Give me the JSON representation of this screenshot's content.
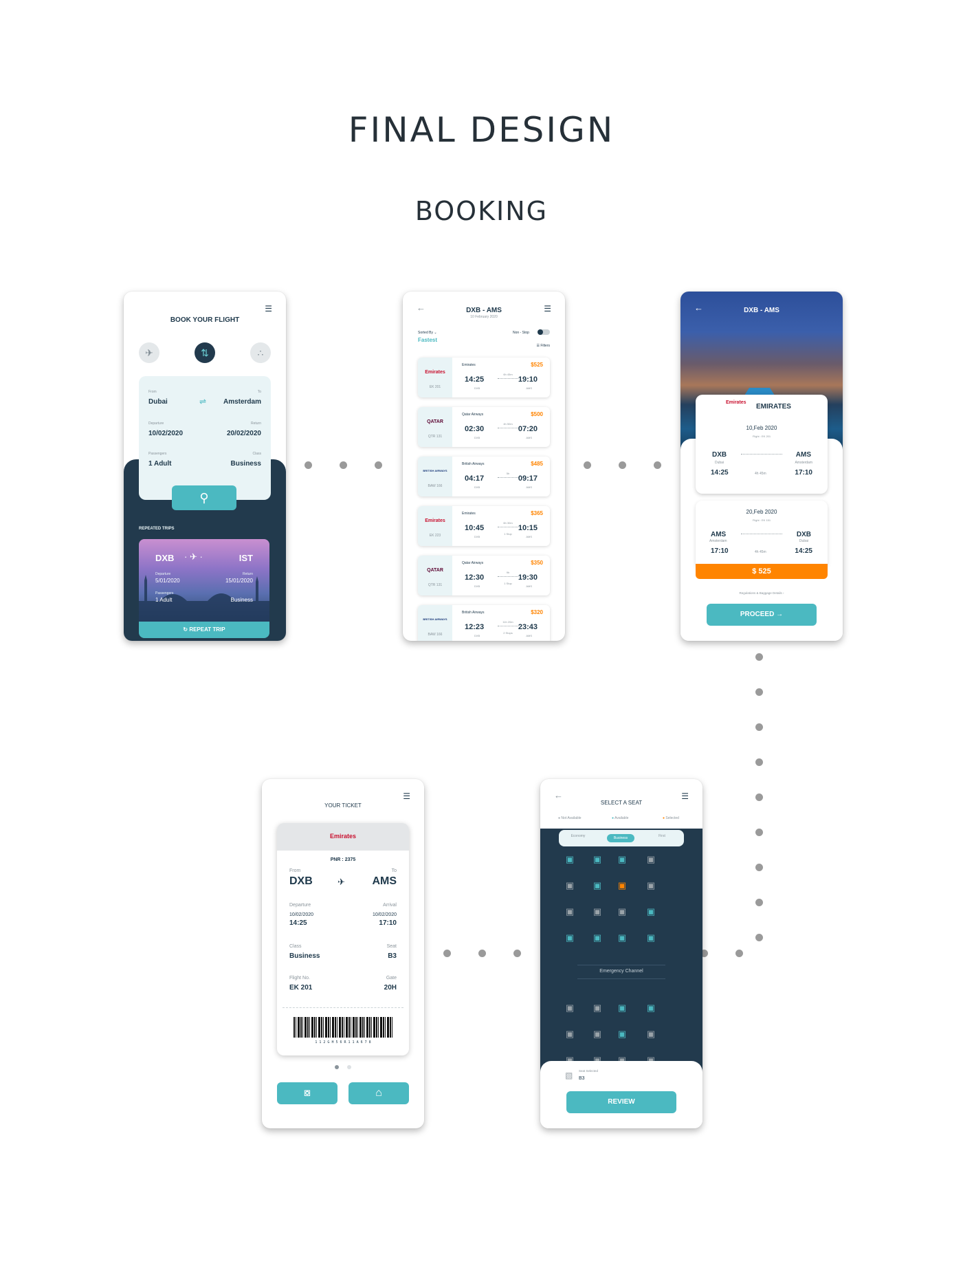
{
  "headings": {
    "main": "FINAL DESIGN",
    "sub": "BOOKING"
  },
  "book": {
    "title": "BOOK YOUR FLIGHT",
    "from_label": "From",
    "from": "Dubai",
    "to_label": "To",
    "to": "Amsterdam",
    "departure_label": "Departure",
    "departure": "10/02/2020",
    "return_label": "Return",
    "return": "20/02/2020",
    "passengers_label": "Passengers",
    "passengers": "1 Adult",
    "class_label": "Class",
    "class": "Business",
    "repeated_title": "REPEATED TRIPS",
    "trip": {
      "from": "DXB",
      "to": "IST",
      "departure_label": "Departure",
      "departure": "5/01/2020",
      "return_label": "Return",
      "return": "15/01/2020",
      "passengers_label": "Passengers",
      "passengers": "1 Adult",
      "class": "Business",
      "repeat_label": "REPEAT TRIP"
    }
  },
  "results": {
    "title": "DXB - AMS",
    "date": "10 February 2020",
    "sorted_label": "Sorted By",
    "sorted_value": "Fastest",
    "nonstop_label": "Non - Stop",
    "filters_label": "Filters",
    "flights": [
      {
        "airline": "Emirates",
        "logo": "Emirates",
        "code": "EK 201",
        "price": "$525",
        "dep": "14:25",
        "arr": "19:10",
        "from": "DXB",
        "to": "AMS",
        "dur": "6h 45m",
        "stops": ""
      },
      {
        "airline": "Qatar Airways",
        "logo": "QATAR",
        "code": "QTR 131",
        "price": "$500",
        "dep": "02:30",
        "arr": "07:20",
        "from": "DXB",
        "to": "AMS",
        "dur": "4h 50m",
        "stops": ""
      },
      {
        "airline": "British Airways",
        "logo": "BRITISH AIRWAYS",
        "code": "BAW 166",
        "price": "$485",
        "dep": "04:17",
        "arr": "09:17",
        "from": "DXB",
        "to": "AMS",
        "dur": "5h",
        "stops": ""
      },
      {
        "airline": "Emirates",
        "logo": "Emirates",
        "code": "EK 223",
        "price": "$365",
        "dep": "10:45",
        "arr": "10:15",
        "from": "DXB",
        "to": "AMS",
        "dur": "6h 30m",
        "stops": "1 Stop"
      },
      {
        "airline": "Qatar Airways",
        "logo": "QATAR",
        "code": "QTR 131",
        "price": "$350",
        "dep": "12:30",
        "arr": "19:30",
        "from": "DXB",
        "to": "AMS",
        "dur": "9h",
        "stops": "1 Stop"
      },
      {
        "airline": "British Airways",
        "logo": "BRITISH AIRWAYS",
        "code": "BAW 166",
        "price": "$320",
        "dep": "12:23",
        "arr": "23:43",
        "from": "DXB",
        "to": "AMS",
        "dur": "11h 20m",
        "stops": "2 Stops"
      }
    ]
  },
  "detail": {
    "title": "DXB - AMS",
    "airline": "EMIRATES",
    "logo": "Emirates",
    "out": {
      "date": "10,Feb 2020",
      "flight": "Flight : EK 201",
      "from": "DXB",
      "from_city": "Dubai",
      "to": "AMS",
      "to_city": "Amsterdam",
      "dep": "14:25",
      "arr": "17:10",
      "dur": "4h 45m"
    },
    "ret": {
      "date": "20,Feb 2020",
      "flight": "Flight : EK 151",
      "from": "AMS",
      "from_city": "Amsterdam",
      "to": "DXB",
      "to_city": "Dubai",
      "dep": "17:10",
      "arr": "14:25",
      "dur": "4h 45m"
    },
    "price": "$ 525",
    "regulations": "Regulations & Baggage Details",
    "proceed": "PROCEED"
  },
  "ticket": {
    "title": "YOUR TICKET",
    "logo": "Emirates",
    "pnr": "PNR : 2375",
    "from_label": "From",
    "from": "DXB",
    "to_label": "To",
    "to": "AMS",
    "departure_label": "Departure",
    "dep_date": "10/02/2020",
    "dep_time": "14:25",
    "arrival_label": "Arrival",
    "arr_date": "10/02/2020",
    "arr_time": "17:10",
    "class_label": "Class",
    "class": "Business",
    "seat_label": "Seat",
    "seat": "B3",
    "flightno_label": "Flight No.",
    "flightno": "EK 201",
    "gate_label": "Gate",
    "gate": "20H",
    "barcode_text": "1 1 2 G H 5 6 R 1 1 A 6 7 8"
  },
  "seats": {
    "title": "SELECT A SEAT",
    "legend": {
      "not_available": "Not Available",
      "available": "Available",
      "selected": "Selected"
    },
    "tabs": [
      "Economy",
      "Business",
      "First"
    ],
    "emergency": "Emergency Channel",
    "seat_selected_label": "Seat Selected",
    "seat_selected": "B3",
    "review": "REVIEW",
    "colors": {
      "available": "#4bb9c1",
      "not_available": "#9aa3a9",
      "selected": "#ff8400"
    }
  },
  "colors": {
    "teal": "#4bb9c1",
    "navy": "#223a4d",
    "orange": "#ff8400"
  }
}
